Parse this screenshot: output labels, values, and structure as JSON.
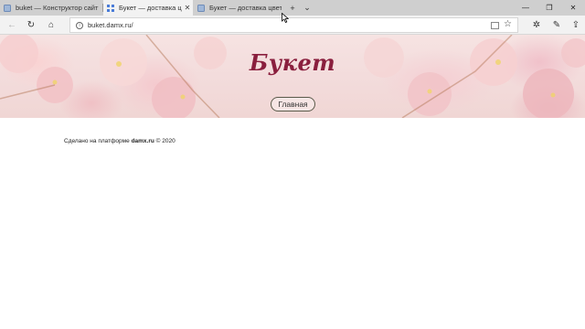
{
  "browser": {
    "tabs": [
      {
        "title": "buket — Конструктор сайт",
        "active": false
      },
      {
        "title": "Букет — доставка цвет",
        "active": true
      },
      {
        "title": "Букет — доставка цветов",
        "active": false
      }
    ],
    "address_bar": {
      "url": "buket.damx.ru/"
    }
  },
  "site": {
    "title": "Букет",
    "nav_button": "Главная",
    "footer": {
      "prefix": "Сделано на платформе",
      "platform": "damx.ru",
      "suffix": "© 2020"
    }
  },
  "colors": {
    "title": "#8a1f3e",
    "tab_strip": "#cfcfcf",
    "active_tab": "#f2f2f2"
  }
}
